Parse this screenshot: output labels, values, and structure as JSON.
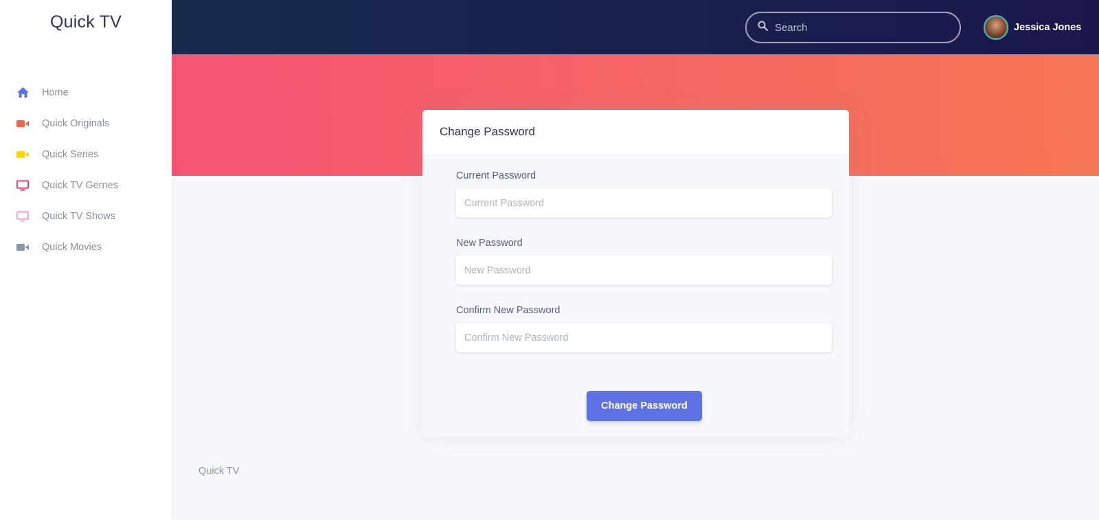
{
  "app": {
    "brand": "Quick TV"
  },
  "sidebar": {
    "items": [
      {
        "label": "Home",
        "icon": "home-icon",
        "color": "#5e72e4"
      },
      {
        "label": "Quick Originals",
        "icon": "video-camera-icon",
        "color": "#fb6340"
      },
      {
        "label": "Quick Series",
        "icon": "video-camera-icon",
        "color": "#ffd600"
      },
      {
        "label": "Quick TV Gernes",
        "icon": "tv-icon",
        "color": "#f5365c"
      },
      {
        "label": "Quick TV Shows",
        "icon": "tv-icon",
        "color": "#f3a4b5"
      },
      {
        "label": "Quick Movies",
        "icon": "video-camera-icon",
        "color": "#8898aa"
      }
    ]
  },
  "header": {
    "search_placeholder": "Search",
    "user_name": "Jessica Jones"
  },
  "card": {
    "title": "Change Password",
    "fields": [
      {
        "label": "Current Password",
        "placeholder": "Current Password",
        "value": ""
      },
      {
        "label": "New Password",
        "placeholder": "New Password",
        "value": ""
      },
      {
        "label": "Confirm New Password",
        "placeholder": "Confirm New Password",
        "value": ""
      }
    ],
    "submit_label": "Change Password"
  },
  "footer": {
    "text": "Quick TV"
  },
  "colors": {
    "primary": "#5e72e4",
    "hero_start": "#f5365c",
    "hero_end": "#f56036",
    "topbar": "#172b4d"
  }
}
